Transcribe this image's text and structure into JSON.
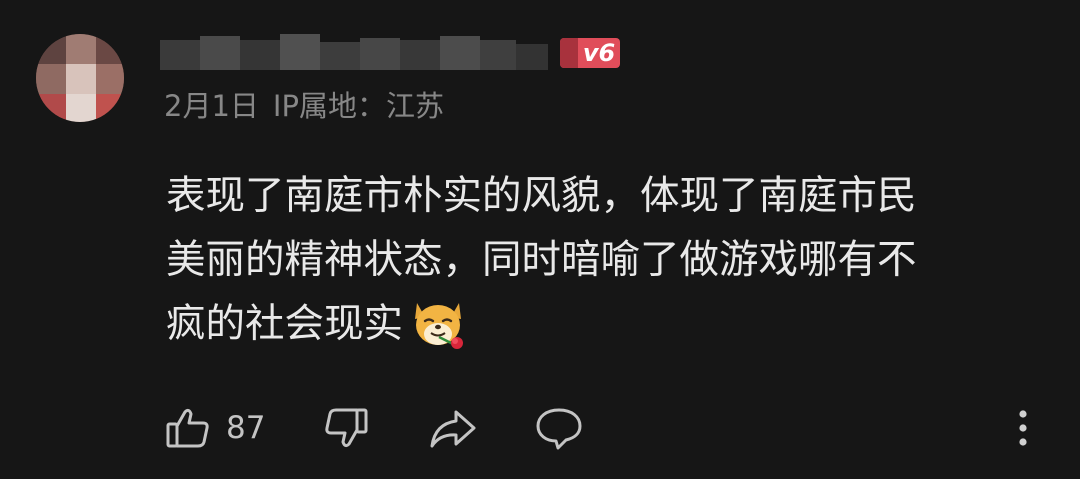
{
  "comment": {
    "user": {
      "level_badge": "v6",
      "avatar_icon": "avatar-icon",
      "badge_color": "#e04d5a"
    },
    "date": "2月1日",
    "ip_location": "IP属地：江苏",
    "lines": [
      "表现了南庭市朴实的风貌，体现了南庭市民",
      "美丽的精神状态，同时暗喻了做游戏哪有不",
      "疯的社会现实"
    ],
    "emoji_icon": "shiba-rose-emoji-icon",
    "actions": {
      "like_count": "87",
      "like_icon": "thumbs-up-icon",
      "dislike_icon": "thumbs-down-icon",
      "share_icon": "share-icon",
      "reply_icon": "comment-icon",
      "more_icon": "more-vertical-icon"
    }
  }
}
